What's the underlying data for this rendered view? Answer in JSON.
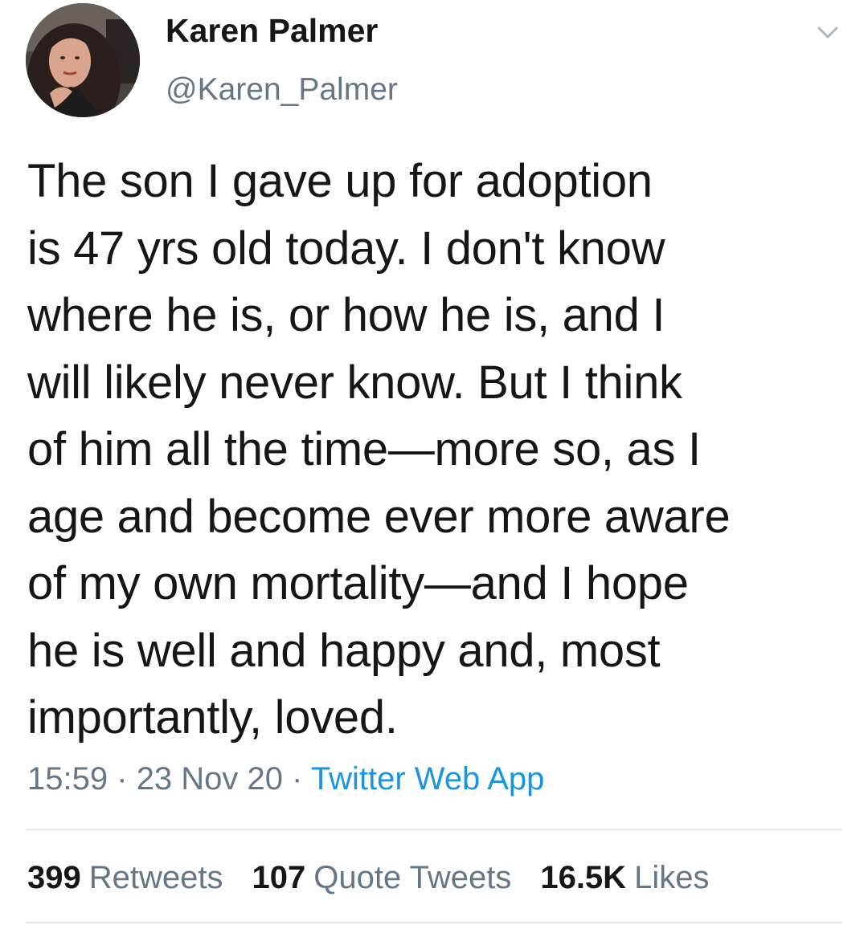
{
  "user": {
    "display_name": "Karen Palmer",
    "handle": "@Karen_Palmer",
    "avatar_icon": "profile-photo"
  },
  "menu": {
    "icon": "chevron-down-icon"
  },
  "tweet": {
    "text": "The son I gave up for adoption\nis 47 yrs old today. I don't know\nwhere he is, or how he is, and I\nwill likely never know. But I think\nof him all the time—more so, as I\nage and become ever more aware\nof my own mortality—and I hope\nhe is well and happy and, most\nimportantly, loved.",
    "time": "15:59",
    "date": "23 Nov 20",
    "separator": "·",
    "source": "Twitter Web App"
  },
  "stats": {
    "retweets_count": "399",
    "retweets_label": "Retweets",
    "quotes_count": "107",
    "quotes_label": "Quote Tweets",
    "likes_count": "16.5K",
    "likes_label": "Likes"
  },
  "colors": {
    "text": "#14171a",
    "secondary": "#657786",
    "link": "#1b95e0",
    "divider": "#e1e8ed"
  }
}
